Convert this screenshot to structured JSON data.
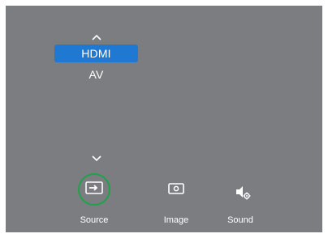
{
  "source_menu": {
    "items": [
      {
        "label": "HDMI",
        "selected": true
      },
      {
        "label": "AV",
        "selected": false
      }
    ],
    "up_icon": "chevron-up-icon",
    "down_icon": "chevron-down-icon"
  },
  "bottom_menu": {
    "items": [
      {
        "label": "Source",
        "icon": "input-source-icon",
        "active": true
      },
      {
        "label": "Image",
        "icon": "image-icon",
        "active": false
      },
      {
        "label": "Sound",
        "icon": "speaker-settings-icon",
        "active": false
      }
    ]
  },
  "colors": {
    "background": "#7b7d80",
    "selection": "#1f78d1",
    "active_ring": "#1fa34a",
    "text": "#ffffff"
  }
}
